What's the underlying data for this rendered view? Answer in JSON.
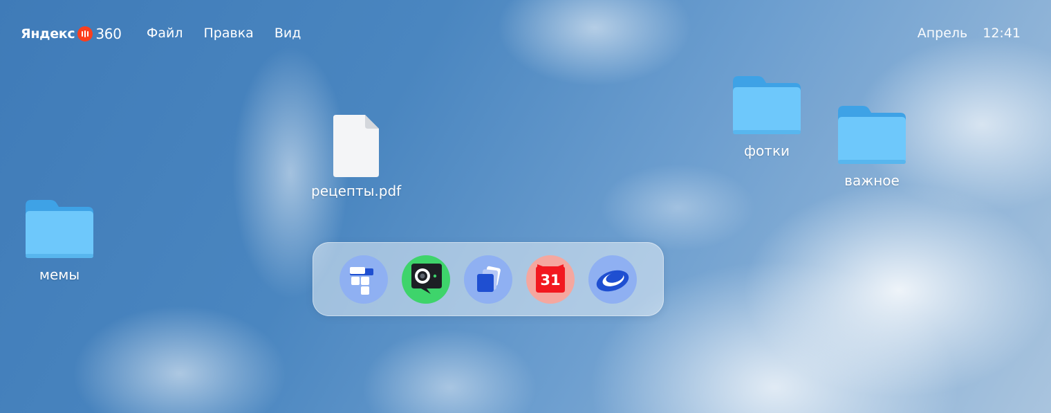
{
  "topbar": {
    "logo": {
      "brand_text": "Яндекс",
      "suffix_text": "360",
      "badge_color": "#fc3f1d"
    },
    "menu": [
      {
        "label": "Файл"
      },
      {
        "label": "Правка"
      },
      {
        "label": "Вид"
      }
    ],
    "month": "Апрель",
    "time": "12:41"
  },
  "desktop": {
    "items": [
      {
        "label": "рецепты.pdf",
        "icon": "pdf-file-icon"
      },
      {
        "label": "фотки",
        "icon": "folder-icon"
      },
      {
        "label": "важное",
        "icon": "folder-icon"
      },
      {
        "label": "мемы",
        "icon": "folder-icon"
      }
    ],
    "folder_color": "#6ec8fb"
  },
  "dock": {
    "apps": [
      {
        "icon": "telemost-app-icon"
      },
      {
        "icon": "messenger-camera-app-icon"
      },
      {
        "icon": "documents-app-icon"
      },
      {
        "icon": "calendar-app-icon",
        "badge": "31"
      },
      {
        "icon": "disk-app-icon"
      }
    ]
  }
}
